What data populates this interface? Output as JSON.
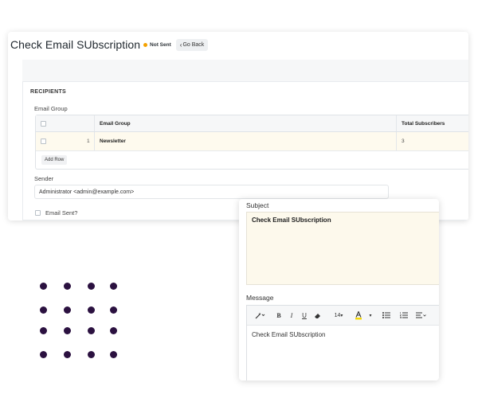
{
  "header": {
    "title": "Check Email SUbscription",
    "status": "Not Sent",
    "go_back": "Go Back"
  },
  "recipients": {
    "section_title": "RECIPIENTS",
    "email_group_label": "Email Group",
    "columns": [
      "Email Group",
      "Total Subscribers"
    ],
    "rows": [
      {
        "index": "1",
        "email_group": "Newsletter",
        "total_subscribers": "3"
      }
    ],
    "add_row": "Add Row"
  },
  "sender": {
    "label": "Sender",
    "value": "Administrator <admin@example.com>"
  },
  "email_sent": {
    "label": "Email Sent?"
  },
  "subject": {
    "label": "Subject",
    "value": "Check Email SUbscription"
  },
  "message": {
    "label": "Message",
    "font_size": "14",
    "body": "Check Email SUbscription"
  },
  "toolbar_icons": [
    "magic-wand-icon",
    "bold-icon",
    "italic-icon",
    "underline-icon",
    "eraser-icon",
    "font-size-select",
    "text-color-icon",
    "bullet-list-icon",
    "numbered-list-icon",
    "align-icon"
  ],
  "colors": {
    "status_dot": "#f4a100",
    "decor_dots": "#2b1140",
    "highlight_yellow": "#f5d90a"
  }
}
